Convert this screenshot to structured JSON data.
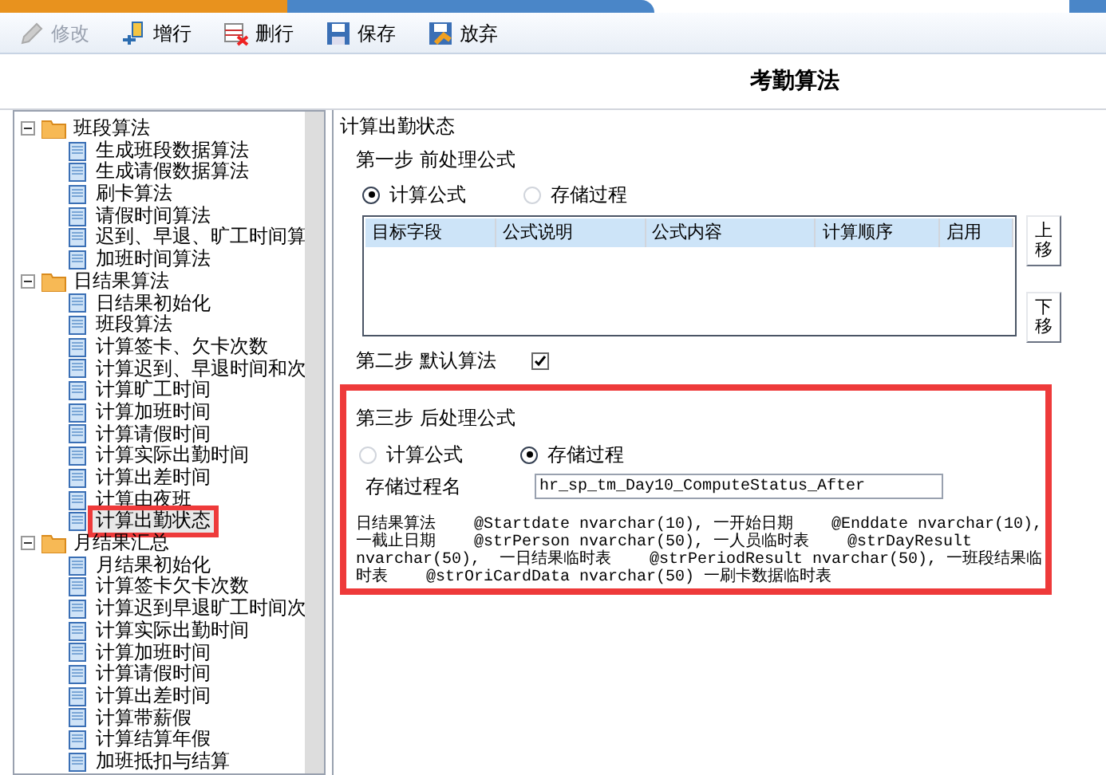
{
  "toolbar": [
    {
      "label": "修改",
      "kind": "edit",
      "disabled": true
    },
    {
      "label": "增行",
      "kind": "add",
      "disabled": false
    },
    {
      "label": "删行",
      "kind": "delete",
      "disabled": false
    },
    {
      "label": "保存",
      "kind": "save",
      "disabled": false
    },
    {
      "label": "放弃",
      "kind": "discard",
      "disabled": false
    }
  ],
  "title": "考勤算法",
  "tree": [
    {
      "label": "班段算法",
      "expanded": true,
      "children": [
        {
          "label": "生成班段数据算法",
          "selected": false
        },
        {
          "label": "生成请假数据算法",
          "selected": false
        },
        {
          "label": "刷卡算法",
          "selected": false
        },
        {
          "label": "请假时间算法",
          "selected": false
        },
        {
          "label": "迟到、早退、旷工时间算",
          "selected": false
        },
        {
          "label": "加班时间算法",
          "selected": false
        }
      ]
    },
    {
      "label": "日结果算法",
      "expanded": true,
      "children": [
        {
          "label": "日结果初始化",
          "selected": false
        },
        {
          "label": "班段算法",
          "selected": false
        },
        {
          "label": "计算签卡、欠卡次数",
          "selected": false
        },
        {
          "label": "计算迟到、早退时间和次",
          "selected": false
        },
        {
          "label": "计算旷工时间",
          "selected": false
        },
        {
          "label": "计算加班时间",
          "selected": false
        },
        {
          "label": "计算请假时间",
          "selected": false
        },
        {
          "label": "计算实际出勤时间",
          "selected": false
        },
        {
          "label": "计算出差时间",
          "selected": false
        },
        {
          "label": "计算由夜班",
          "selected": false
        },
        {
          "label": "计算出勤状态",
          "selected": true
        }
      ]
    },
    {
      "label": "月结果汇总",
      "expanded": true,
      "children": [
        {
          "label": "月结果初始化",
          "selected": false
        },
        {
          "label": "计算签卡欠卡次数",
          "selected": false
        },
        {
          "label": "计算迟到早退旷工时间次",
          "selected": false
        },
        {
          "label": "计算实际出勤时间",
          "selected": false
        },
        {
          "label": "计算加班时间",
          "selected": false
        },
        {
          "label": "计算请假时间",
          "selected": false
        },
        {
          "label": "计算出差时间",
          "selected": false
        },
        {
          "label": "计算带薪假",
          "selected": false
        },
        {
          "label": "计算结算年假",
          "selected": false
        },
        {
          "label": "加班抵扣与结算",
          "selected": false
        }
      ]
    }
  ],
  "panel": {
    "title": "计算出勤状态",
    "step1": {
      "label": "第一步 前处理公式",
      "options": [
        {
          "label": "计算公式",
          "selected": true
        },
        {
          "label": "存储过程",
          "selected": false
        }
      ],
      "columns": [
        "目标字段",
        "公式说明",
        "公式内容",
        "计算顺序",
        "启用"
      ],
      "buttons": [
        "上移",
        "下移"
      ]
    },
    "step2": {
      "label": "第二步 默认算法",
      "checked": true
    },
    "step3": {
      "label": "第三步 后处理公式",
      "options": [
        {
          "label": "计算公式",
          "selected": false
        },
        {
          "label": "存储过程",
          "selected": true
        }
      ],
      "proc_label": "存储过程名",
      "proc_value": "hr_sp_tm_Day10_ComputeStatus_After",
      "note": "日结果算法    @Startdate nvarchar(10), 一开始日期    @Enddate nvarchar(10), 一截止日期    @strPerson nvarchar(50), 一人员临时表    @strDayResult nvarchar(50),  一日结果临时表    @strPeriodResult nvarchar(50), 一班段结果临时表    @strOriCardData nvarchar(50) 一刷卡数据临时表"
    }
  }
}
